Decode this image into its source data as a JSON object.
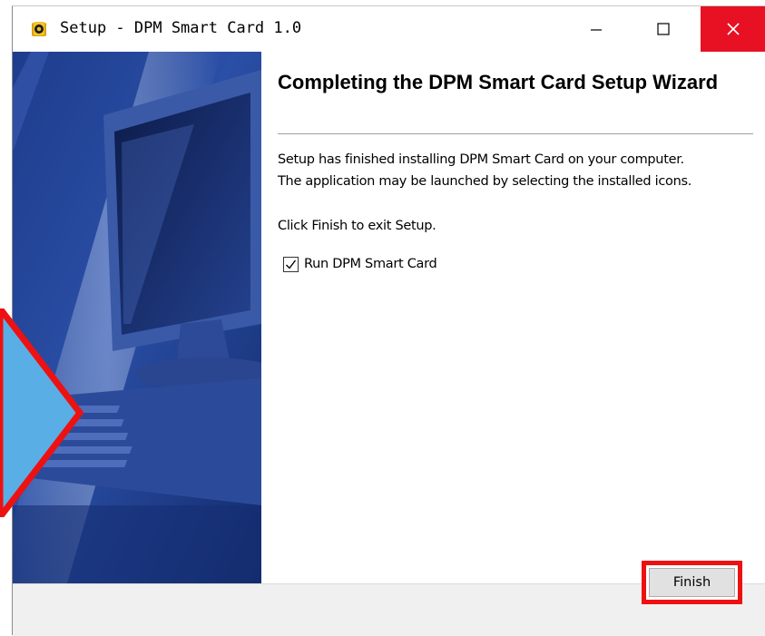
{
  "window": {
    "title": "Setup - DPM Smart Card 1.0",
    "controls": {
      "minimize_icon": "minimize-icon",
      "maximize_icon": "maximize-icon",
      "close_icon": "close-icon"
    },
    "close_color": "#e81123"
  },
  "content": {
    "heading": "Completing the DPM Smart Card Setup Wizard",
    "paragraph1_line1": "Setup has finished installing DPM Smart Card on your computer.",
    "paragraph1_line2": "The application may be launched by selecting the installed icons.",
    "paragraph2": "Click Finish to exit Setup.",
    "run_checkbox": {
      "label": "Run DPM Smart Card",
      "checked": true
    }
  },
  "footer": {
    "finish_label": "Finish"
  },
  "annotation": {
    "highlight_color": "#ee1111",
    "arrow_fill": "#5aaee6"
  }
}
